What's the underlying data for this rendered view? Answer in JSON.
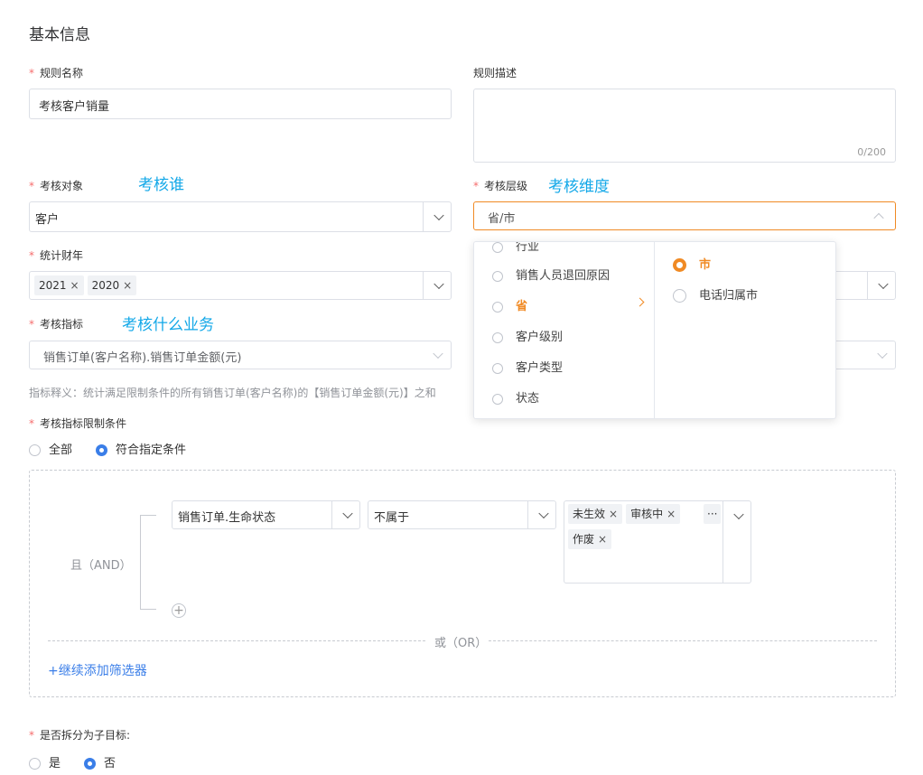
{
  "section_title": "基本信息",
  "rule_name": {
    "label": "规则名称",
    "value": "考核客户销量"
  },
  "rule_desc": {
    "label": "规则描述",
    "counter": "0/200"
  },
  "assess_object": {
    "label": "考核对象",
    "value": "客户",
    "note": "考核谁"
  },
  "assess_level": {
    "label": "考核层级",
    "value": "省/市",
    "note": "考核维度"
  },
  "fiscal_year": {
    "label": "统计财年",
    "tags": [
      "2021",
      "2020"
    ]
  },
  "metric": {
    "label": "考核指标",
    "value": "销售订单(客户名称).销售订单金额(元)",
    "note": "考核什么业务",
    "hint": "指标释义：统计满足限制条件的所有销售订单(客户名称)的【销售订单金额(元)】之和"
  },
  "dropdown": {
    "left_items": [
      "行业",
      "销售人员退回原因",
      "省",
      "客户级别",
      "客户类型",
      "状态"
    ],
    "active_index": 2,
    "right_items": [
      "市",
      "电话归属市"
    ],
    "selected_right": 0
  },
  "condition": {
    "label": "考核指标限制条件",
    "options": [
      "全部",
      "符合指定条件"
    ],
    "selected": 1
  },
  "filter": {
    "and_label": "且（AND）",
    "field": "销售订单.生命状态",
    "operator": "不属于",
    "value_tags": [
      "未生效",
      "审核中",
      "作废"
    ],
    "more": "···",
    "or_label": "或（OR）",
    "add_label": "+继续添加筛选器",
    "add_icon": "+"
  },
  "split": {
    "label": "是否拆分为子目标:",
    "options": [
      "是",
      "否"
    ],
    "selected": 1
  },
  "colors": {
    "accent": "#3a7ee8",
    "orange": "#f08a24",
    "note": "#13a8e8",
    "required": "#f56c6c"
  }
}
